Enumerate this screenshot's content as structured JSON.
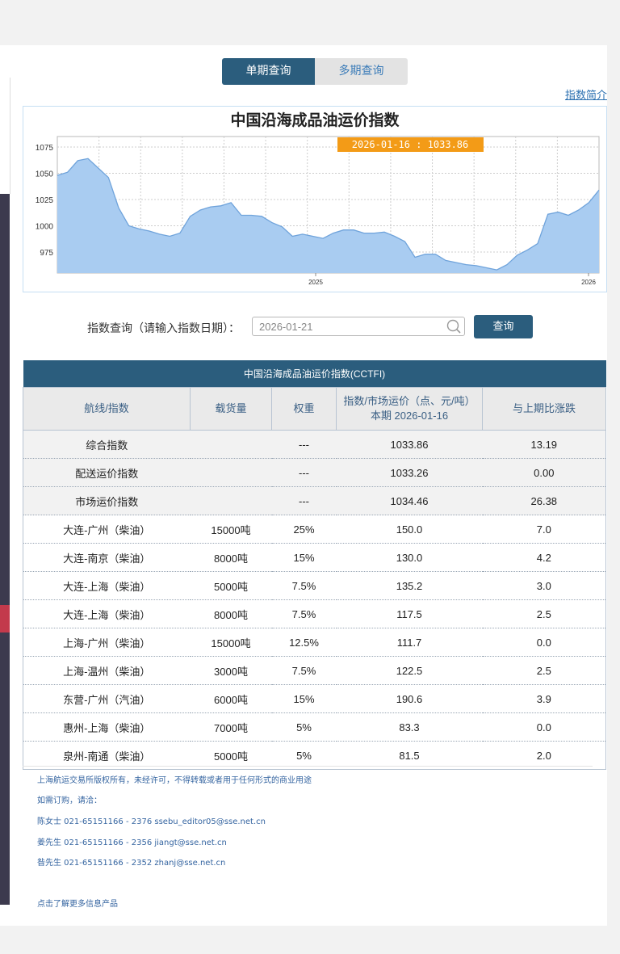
{
  "tabs": [
    {
      "label": "单期查询",
      "active": true
    },
    {
      "label": "多期查询",
      "active": false
    }
  ],
  "intro_link": "指数简介",
  "chart_data": {
    "type": "area",
    "title": "中国沿海成品油运价指数",
    "tooltip": "2026-01-16 : 1033.86",
    "ylim": [
      955,
      1085
    ],
    "yticks": [
      975,
      1000,
      1025,
      1050,
      1075
    ],
    "xticks": [
      "2025",
      "2026"
    ],
    "values": [
      1048,
      1051,
      1062,
      1064,
      1055,
      1046,
      1017,
      1000,
      997,
      995,
      992,
      990,
      993,
      1009,
      1015,
      1018,
      1019,
      1022,
      1010,
      1010,
      1009,
      1003,
      999,
      990,
      992,
      990,
      988,
      993,
      996,
      996,
      993,
      993,
      994,
      990,
      985,
      970,
      973,
      973,
      967,
      965,
      963,
      962,
      960,
      958,
      963,
      972,
      977,
      983,
      1011,
      1013,
      1010,
      1015,
      1022,
      1034
    ],
    "fill_color": "#a9ccf1",
    "line_color": "#6fa3db",
    "tooltip_color": "#f39b17"
  },
  "query": {
    "label": "指数查询（请输入指数日期）：",
    "value": "2026-01-21",
    "button": "查询"
  },
  "table": {
    "caption": "中国沿海成品油运价指数(CCTFI)",
    "headers": [
      "航线/指数",
      "载货量",
      "权重",
      "指数/市场运价（点、元/吨）",
      "本期 2026-01-16",
      "与上期比涨跌"
    ],
    "summary_rows": [
      {
        "name": "综合指数",
        "weight": "---",
        "value": "1033.86",
        "change": "13.19"
      },
      {
        "name": "配送运价指数",
        "weight": "---",
        "value": "1033.26",
        "change": "0.00"
      },
      {
        "name": "市场运价指数",
        "weight": "---",
        "value": "1034.46",
        "change": "26.38"
      }
    ],
    "route_rows": [
      {
        "name": "大连-广州（柴油）",
        "load": "15000吨",
        "weight": "25%",
        "value": "150.0",
        "change": "7.0"
      },
      {
        "name": "大连-南京（柴油）",
        "load": "8000吨",
        "weight": "15%",
        "value": "130.0",
        "change": "4.2"
      },
      {
        "name": "大连-上海（柴油）",
        "load": "5000吨",
        "weight": "7.5%",
        "value": "135.2",
        "change": "3.0"
      },
      {
        "name": "大连-上海（柴油）",
        "load": "8000吨",
        "weight": "7.5%",
        "value": "117.5",
        "change": "2.5"
      },
      {
        "name": "上海-广州（柴油）",
        "load": "15000吨",
        "weight": "12.5%",
        "value": "111.7",
        "change": "0.0"
      },
      {
        "name": "上海-温州（柴油）",
        "load": "3000吨",
        "weight": "7.5%",
        "value": "122.5",
        "change": "2.5"
      },
      {
        "name": "东营-广州（汽油）",
        "load": "6000吨",
        "weight": "15%",
        "value": "190.6",
        "change": "3.9"
      },
      {
        "name": "惠州-上海（柴油）",
        "load": "7000吨",
        "weight": "5%",
        "value": "83.3",
        "change": "0.0"
      },
      {
        "name": "泉州-南通（柴油）",
        "load": "5000吨",
        "weight": "5%",
        "value": "81.5",
        "change": "2.0"
      }
    ]
  },
  "footer": {
    "copyright": "上海航运交易所版权所有，未经许可，不得转载或者用于任何形式的商业用途",
    "order_label": "如需订购，请洽：",
    "contacts": [
      "陈女士 021-65151166 - 2376 ssebu_editor05@sse.net.cn",
      "姜先生 021-65151166 - 2356 jiangt@sse.net.cn",
      "昝先生 021-65151166 - 2352 zhanj@sse.net.cn"
    ],
    "more_link": "点击了解更多信息产品"
  }
}
